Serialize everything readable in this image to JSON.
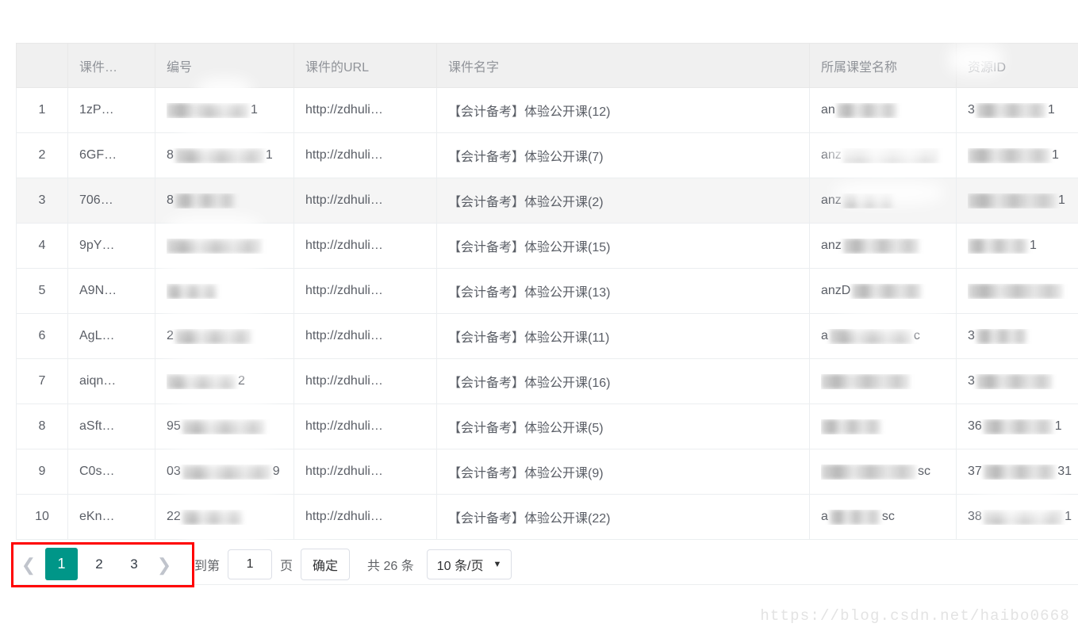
{
  "theme": {
    "accent": "#009688",
    "annotation": "#ff0000",
    "header_bg": "#f0f0f0",
    "row_hover_bg": "#f5f5f5",
    "text": "#5a5e66",
    "muted_text": "#909399",
    "border": "#ebeef0"
  },
  "table": {
    "columns": [
      {
        "key": "idx",
        "label": ""
      },
      {
        "key": "key",
        "label": "课件…"
      },
      {
        "key": "num",
        "label": "编号"
      },
      {
        "key": "url",
        "label": "课件的URL"
      },
      {
        "key": "name",
        "label": "课件名字"
      },
      {
        "key": "class",
        "label": "所属课堂名称"
      },
      {
        "key": "res",
        "label": "资源ID"
      }
    ],
    "rows": [
      {
        "idx": "1",
        "key": "1zP…",
        "num_lead": "",
        "num_tail": "1",
        "url": "http://zdhuli…",
        "name": "【会计备考】体验公开课(12)",
        "class_lead": "an",
        "class_tail": "",
        "res_lead": "3",
        "res_tail": "1",
        "hovered": false
      },
      {
        "idx": "2",
        "key": "6GF…",
        "num_lead": "8",
        "num_tail": "1",
        "url": "http://zdhuli…",
        "name": "【会计备考】体验公开课(7)",
        "class_lead": "anz",
        "class_tail": "",
        "res_lead": "",
        "res_tail": "1",
        "hovered": false
      },
      {
        "idx": "3",
        "key": "706…",
        "num_lead": "8",
        "num_tail": "",
        "url": "http://zdhuli…",
        "name": "【会计备考】体验公开课(2)",
        "class_lead": "anz",
        "class_tail": "",
        "res_lead": "",
        "res_tail": "1",
        "hovered": true
      },
      {
        "idx": "4",
        "key": "9pY…",
        "num_lead": "",
        "num_tail": "",
        "url": "http://zdhuli…",
        "name": "【会计备考】体验公开课(15)",
        "class_lead": "anz",
        "class_tail": "",
        "res_lead": "",
        "res_tail": "1",
        "hovered": false
      },
      {
        "idx": "5",
        "key": "A9N…",
        "num_lead": "",
        "num_tail": "",
        "url": "http://zdhuli…",
        "name": "【会计备考】体验公开课(13)",
        "class_lead": "anzD",
        "class_tail": "",
        "res_lead": "",
        "res_tail": "",
        "hovered": false
      },
      {
        "idx": "6",
        "key": "AgL…",
        "num_lead": "2",
        "num_tail": "",
        "url": "http://zdhuli…",
        "name": "【会计备考】体验公开课(11)",
        "class_lead": "a",
        "class_tail": "c",
        "res_lead": "3",
        "res_tail": "",
        "hovered": false
      },
      {
        "idx": "7",
        "key": "aiqn…",
        "num_lead": "",
        "num_tail": "2",
        "url": "http://zdhuli…",
        "name": "【会计备考】体验公开课(16)",
        "class_lead": "",
        "class_tail": "",
        "res_lead": "3",
        "res_tail": "",
        "hovered": false
      },
      {
        "idx": "8",
        "key": "aSft…",
        "num_lead": "95",
        "num_tail": "",
        "url": "http://zdhuli…",
        "name": "【会计备考】体验公开课(5)",
        "class_lead": "",
        "class_tail": "",
        "res_lead": "36",
        "res_tail": "1",
        "hovered": false
      },
      {
        "idx": "9",
        "key": "C0s…",
        "num_lead": "03",
        "num_tail": "9",
        "url": "http://zdhuli…",
        "name": "【会计备考】体验公开课(9)",
        "class_lead": "",
        "class_tail": "sc",
        "res_lead": "37",
        "res_tail": "31",
        "hovered": false
      },
      {
        "idx": "10",
        "key": "eKn…",
        "num_lead": "22",
        "num_tail": "",
        "url": "http://zdhuli…",
        "name": "【会计备考】体验公开课(22)",
        "class_lead": "a",
        "class_tail": "sc",
        "res_lead": "38",
        "res_tail": "1",
        "hovered": false
      }
    ]
  },
  "pagination": {
    "prev_icon": "chevron-left",
    "next_icon": "chevron-right",
    "pages": [
      "1",
      "2",
      "3"
    ],
    "active_page": "1",
    "jump_prefix": "到第",
    "jump_value": "1",
    "jump_suffix": "页",
    "confirm_label": "确定",
    "total_label": "共 26 条",
    "page_size_label": "10 条/页",
    "caret_icon": "▼"
  },
  "watermark": {
    "text": "https://blog.csdn.net/haibo0668"
  }
}
